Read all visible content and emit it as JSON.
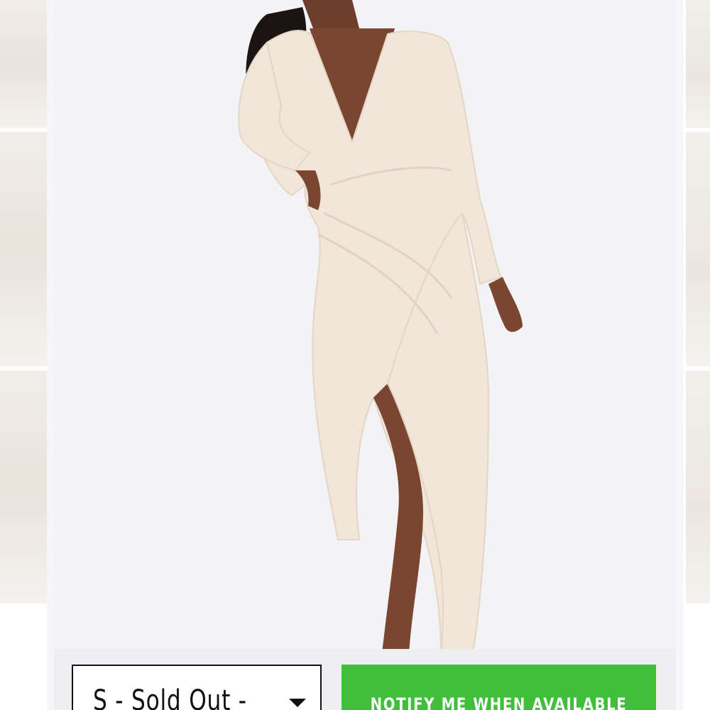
{
  "product": {
    "image_alt_icon": "product-photo",
    "dress_color": "#f1e6d9"
  },
  "size_selector": {
    "selected": "S - Sold Out -"
  },
  "notify_button": {
    "label": "NOTIFY ME WHEN AVAILABLE",
    "color": "#3fbf3a"
  },
  "thumbnails": {
    "left_count": 3,
    "right_count": 3
  }
}
